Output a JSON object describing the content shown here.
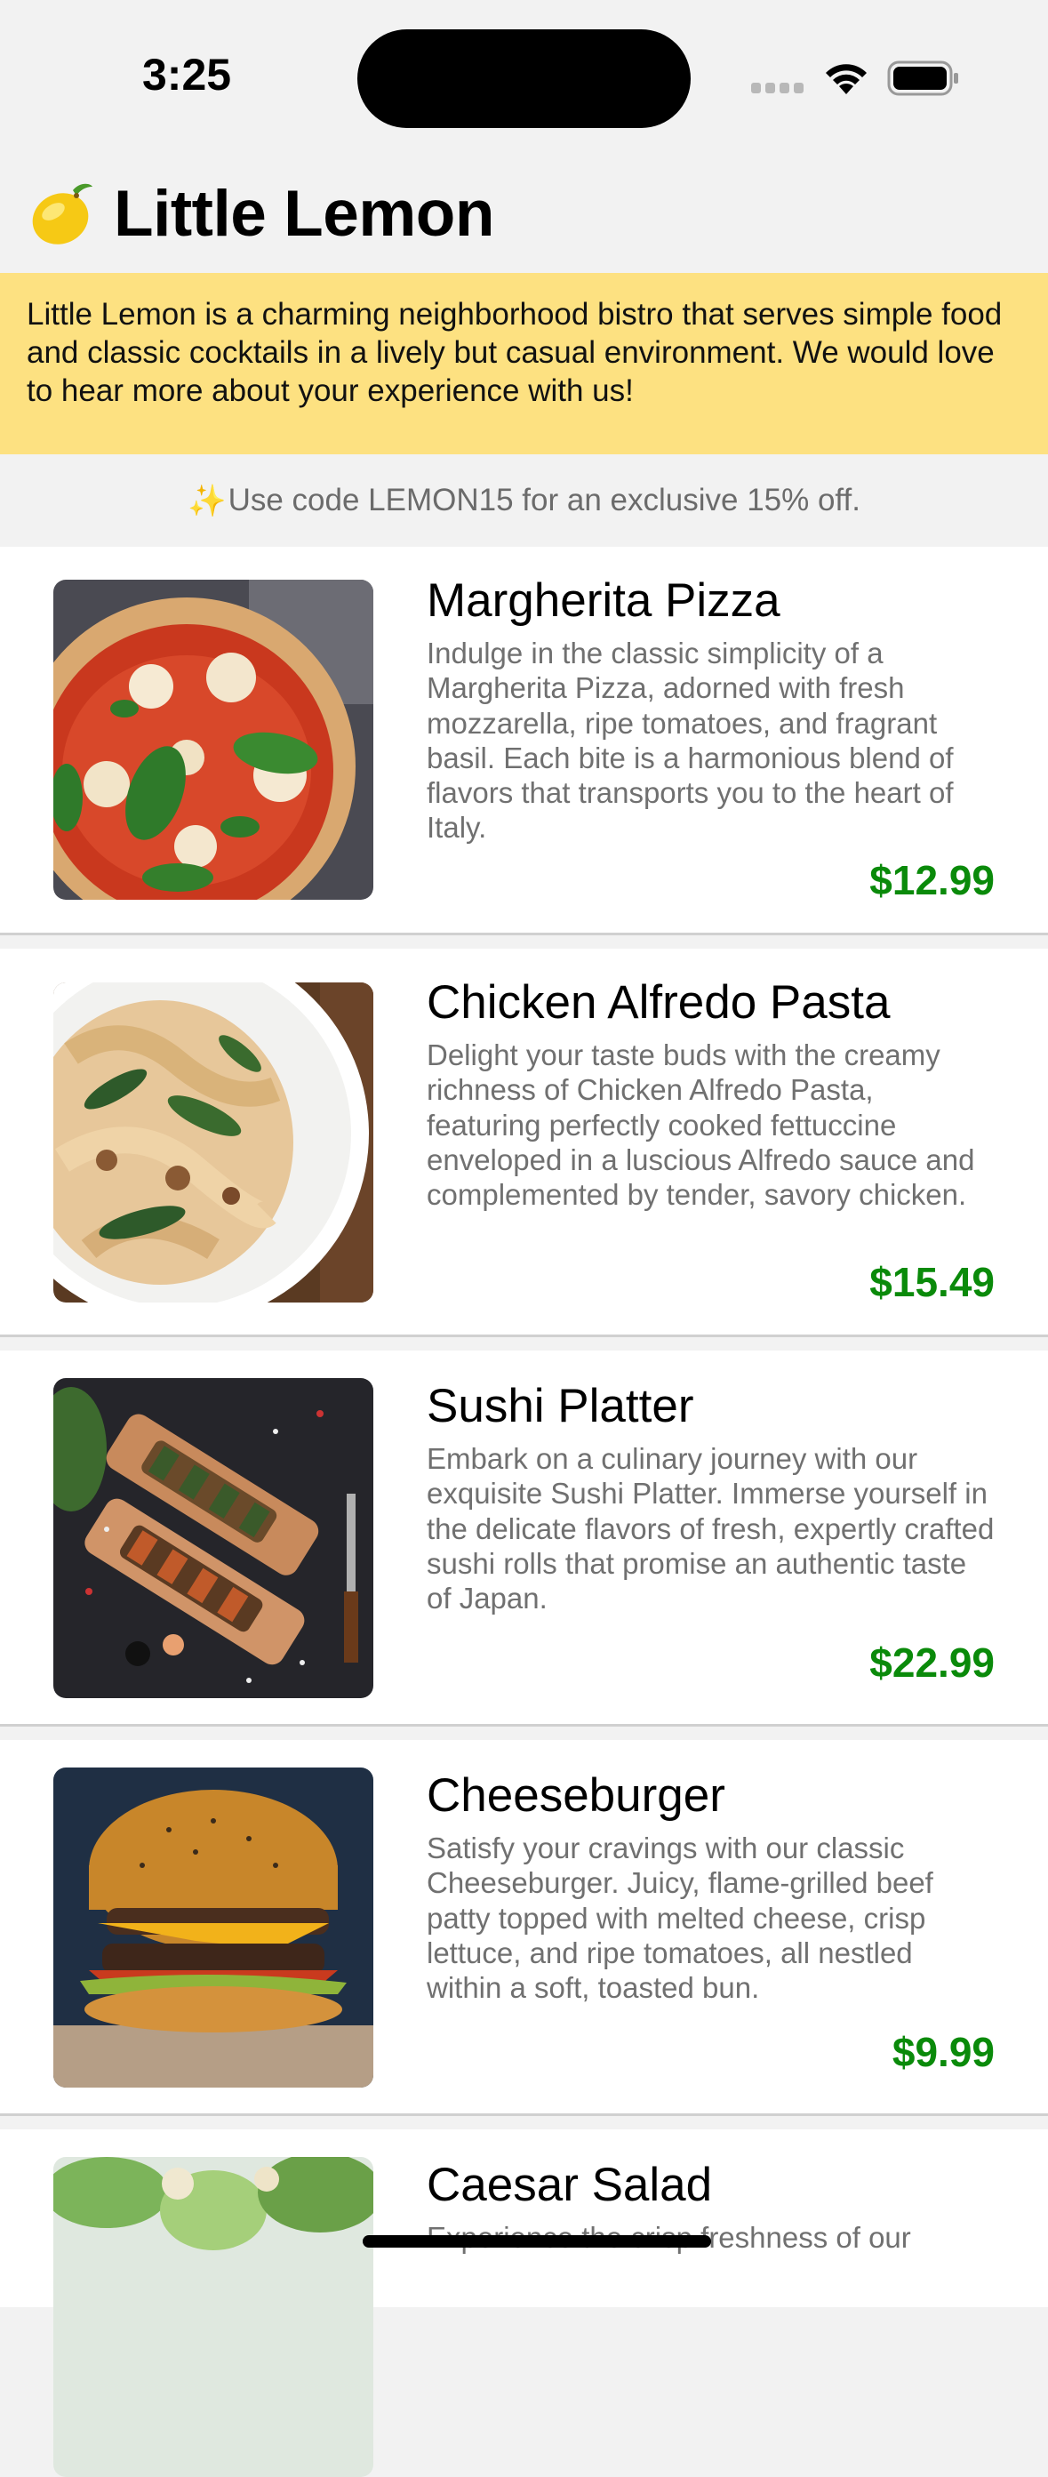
{
  "status_bar": {
    "time": "3:25"
  },
  "header": {
    "emoji": "🍋",
    "title": "Little Lemon"
  },
  "intro": {
    "text": "Little Lemon is a charming neighborhood bistro that serves simple food and classic cocktails in a lively but casual environment. We would love to hear more about your experience with us!"
  },
  "promo": {
    "sparkle": "✨",
    "text": "Use code LEMON15 for an exclusive 15% off."
  },
  "colors": {
    "banner": "#fde181",
    "price": "#0a8a0a",
    "background": "#f2f2f2"
  },
  "menu": {
    "items": [
      {
        "name": "Margherita Pizza",
        "description": "Indulge in the classic simplicity of a Margherita Pizza, adorned with fresh mozzarella, ripe tomatoes, and fragrant basil. Each bite is a harmonious blend of flavors that transports you to the heart of Italy.",
        "price": "$12.99",
        "image": "pizza-photo"
      },
      {
        "name": "Chicken Alfredo Pasta",
        "description": "Delight your taste buds with the creamy richness of Chicken Alfredo Pasta, featuring perfectly cooked fettuccine enveloped in a luscious Alfredo sauce and complemented by tender, savory chicken.",
        "price": "$15.49",
        "image": "pasta-photo"
      },
      {
        "name": "Sushi Platter",
        "description": "Embark on a culinary journey with our exquisite Sushi Platter. Immerse yourself in the delicate flavors of fresh, expertly crafted sushi rolls that promise an authentic taste of Japan.",
        "price": "$22.99",
        "image": "sushi-photo"
      },
      {
        "name": "Cheeseburger",
        "description": "Satisfy your cravings with our classic Cheeseburger. Juicy, flame-grilled beef patty topped with melted cheese, crisp lettuce, and ripe tomatoes, all nestled within a soft, toasted bun.",
        "price": "$9.99",
        "image": "burger-photo"
      },
      {
        "name": "Caesar Salad",
        "description": "Experience the crisp freshness of our",
        "image": "salad-photo"
      }
    ]
  }
}
